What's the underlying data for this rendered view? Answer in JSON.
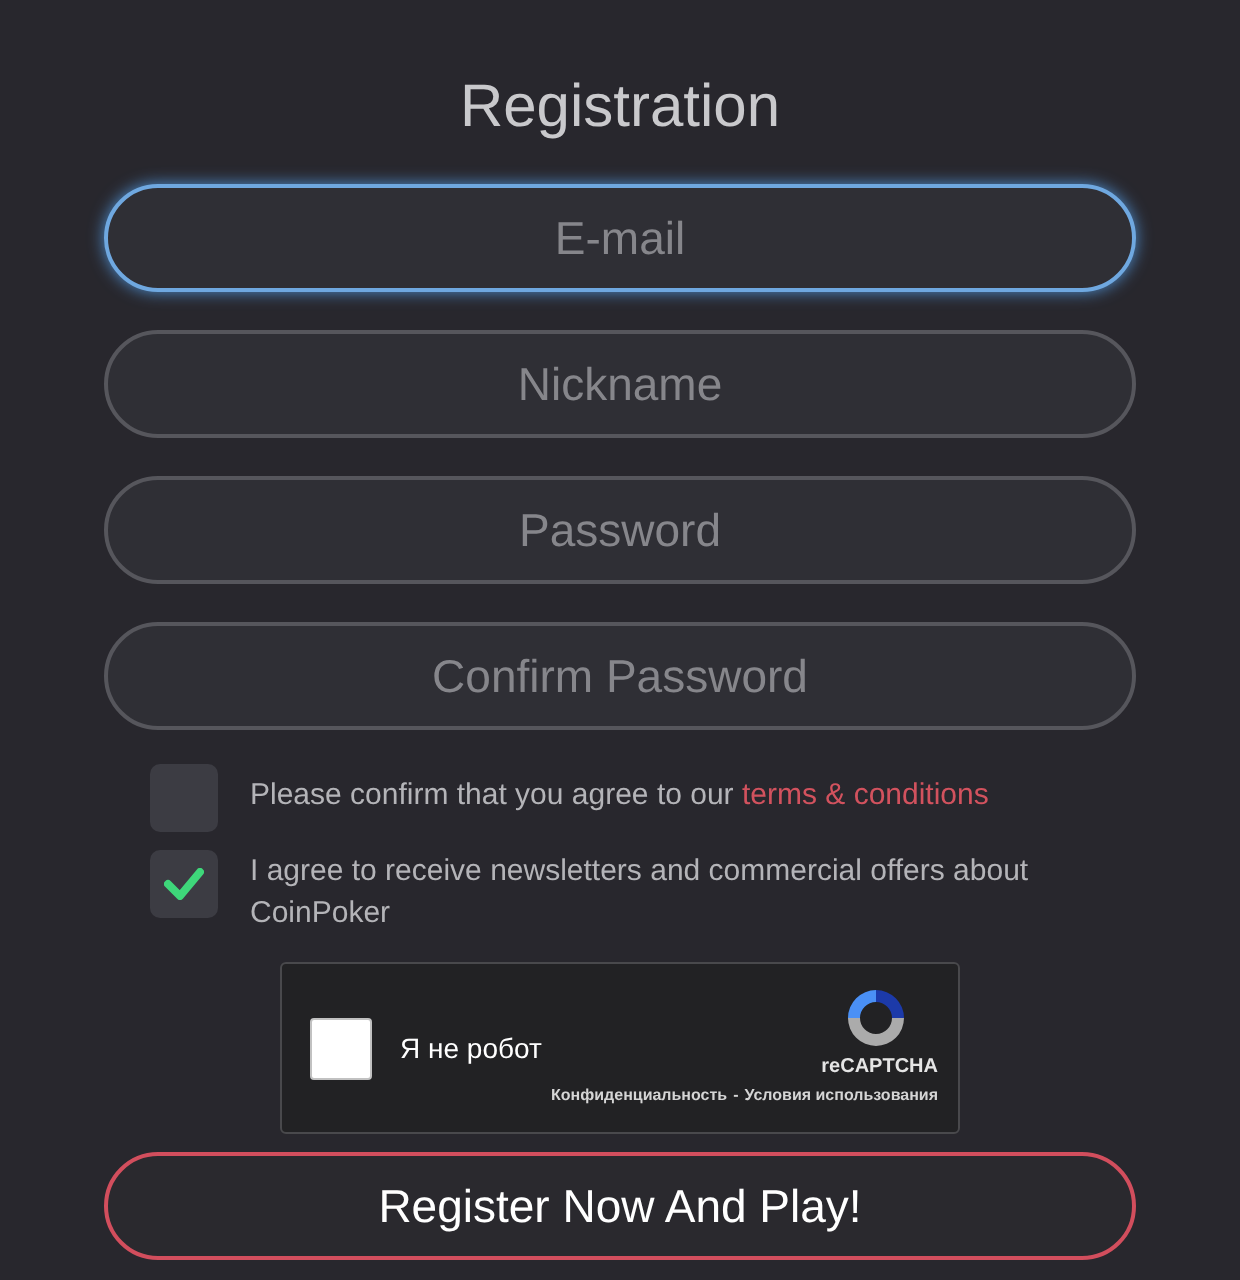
{
  "title": "Registration",
  "fields": [
    {
      "placeholder": "E-mail",
      "focused": true
    },
    {
      "placeholder": "Nickname",
      "focused": false
    },
    {
      "placeholder": "Password",
      "focused": false
    },
    {
      "placeholder": "Confirm Password",
      "focused": false
    }
  ],
  "agreements": [
    {
      "text": "Please confirm that you agree to our ",
      "link": "terms & conditions",
      "checked": false
    },
    {
      "text": "I agree to receive newsletters and commercial offers about CoinPoker",
      "checked": true
    }
  ],
  "captcha": {
    "label": "Я не робот",
    "checked": false,
    "brand": "reCAPTCHA",
    "privacy": "Конфиденциальность",
    "separator": "-",
    "terms": "Условия использования"
  },
  "submit": "Register Now And Play!"
}
